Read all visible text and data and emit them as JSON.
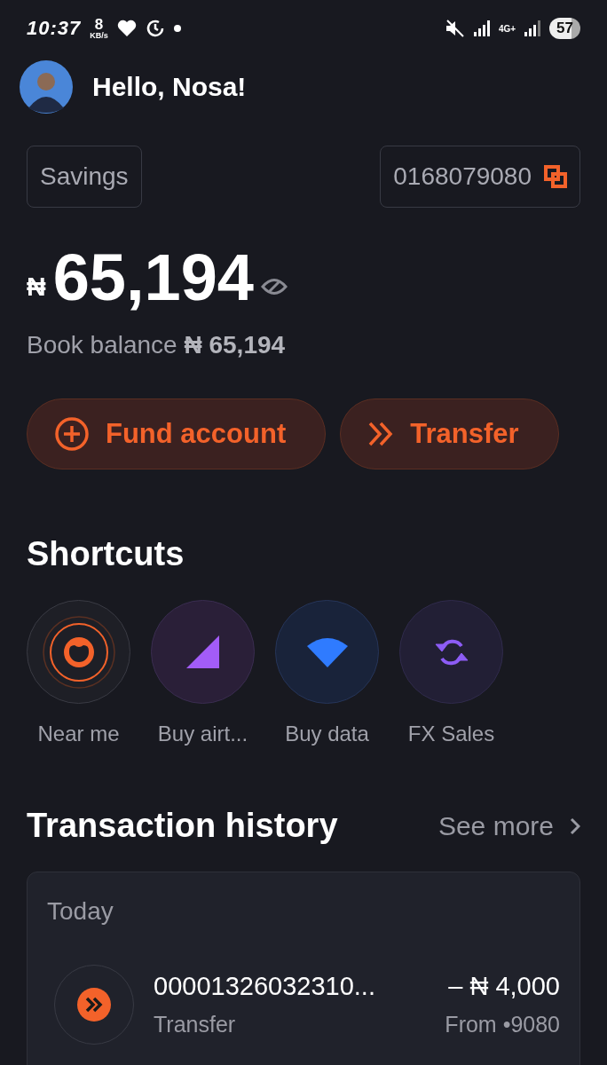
{
  "status_bar": {
    "time": "10:37",
    "speed": "8",
    "speed_unit": "KB/s",
    "network": "4G+",
    "battery": "57"
  },
  "greeting": "Hello, Nosa!",
  "account": {
    "type": "Savings",
    "number": "0168079080"
  },
  "balance": {
    "currency": "₦",
    "amount": "65,194",
    "book_balance": "Book balance **₦ 65,194**"
  },
  "actions": [
    {
      "kind": "fund",
      "label": "Fund account"
    },
    {
      "kind": "transfer",
      "label": "Transfer"
    }
  ],
  "shortcuts": {
    "title": "Shortcuts",
    "items": [
      {
        "kind": "near",
        "label": "Near me"
      },
      {
        "kind": "airtime",
        "label": "Buy airt..."
      },
      {
        "kind": "data",
        "label": "Buy data"
      },
      {
        "kind": "fx",
        "label": "FX Sales"
      }
    ]
  },
  "history": {
    "title": "Transaction history",
    "see_more": "See more",
    "groups": [
      {
        "date": "Today",
        "transactions": [
          {
            "kind": "transfer",
            "reference": "00001326032310...",
            "type": "Transfer",
            "amount": "– ₦ 4,000",
            "source": "From •9080"
          }
        ]
      }
    ]
  }
}
